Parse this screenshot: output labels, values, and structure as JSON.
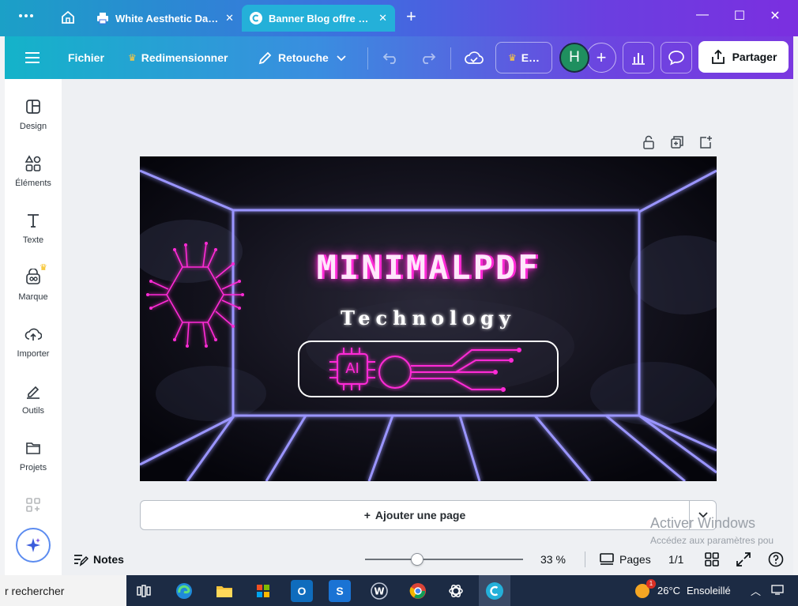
{
  "browser": {
    "tabs": [
      {
        "title": "White Aesthetic Da…",
        "active": false
      },
      {
        "title": "Banner Blog offre …",
        "active": true
      }
    ]
  },
  "toolbar": {
    "file_label": "Fichier",
    "resize_label": "Redimensionner",
    "edit_label": "Retouche",
    "upgrade_label": "E…",
    "avatar_initial": "H",
    "share_label": "Partager"
  },
  "sidebar": {
    "items": [
      {
        "label": "Design",
        "icon": "layout-icon"
      },
      {
        "label": "Éléments",
        "icon": "shapes-icon"
      },
      {
        "label": "Texte",
        "icon": "text-icon"
      },
      {
        "label": "Marque",
        "icon": "brand-icon"
      },
      {
        "label": "Importer",
        "icon": "cloud-upload-icon"
      },
      {
        "label": "Outils",
        "icon": "tools-icon"
      },
      {
        "label": "Projets",
        "icon": "folder-icon"
      }
    ]
  },
  "design": {
    "title": "MINIMALPDF",
    "subtitle": "Technology",
    "chip_label": "AI"
  },
  "canvas": {
    "add_page_label": "Ajouter une page"
  },
  "status": {
    "notes_label": "Notes",
    "zoom": "33 %",
    "zoom_fraction": 0.33,
    "pages_label": "Pages",
    "page_count": "1/1"
  },
  "watermark": {
    "title": "Activer Windows",
    "subtitle": "Accédez aux paramètres pou"
  },
  "taskbar": {
    "search_text": "r rechercher",
    "weather_temp": "26°C",
    "weather_desc": "Ensoleillé",
    "notification_count": "1"
  },
  "colors": {
    "neon_frame": "#8f8bff",
    "neon_pink": "#ff2bd6",
    "toolbar_start": "#14b3c9",
    "toolbar_end": "#7a38e0"
  }
}
